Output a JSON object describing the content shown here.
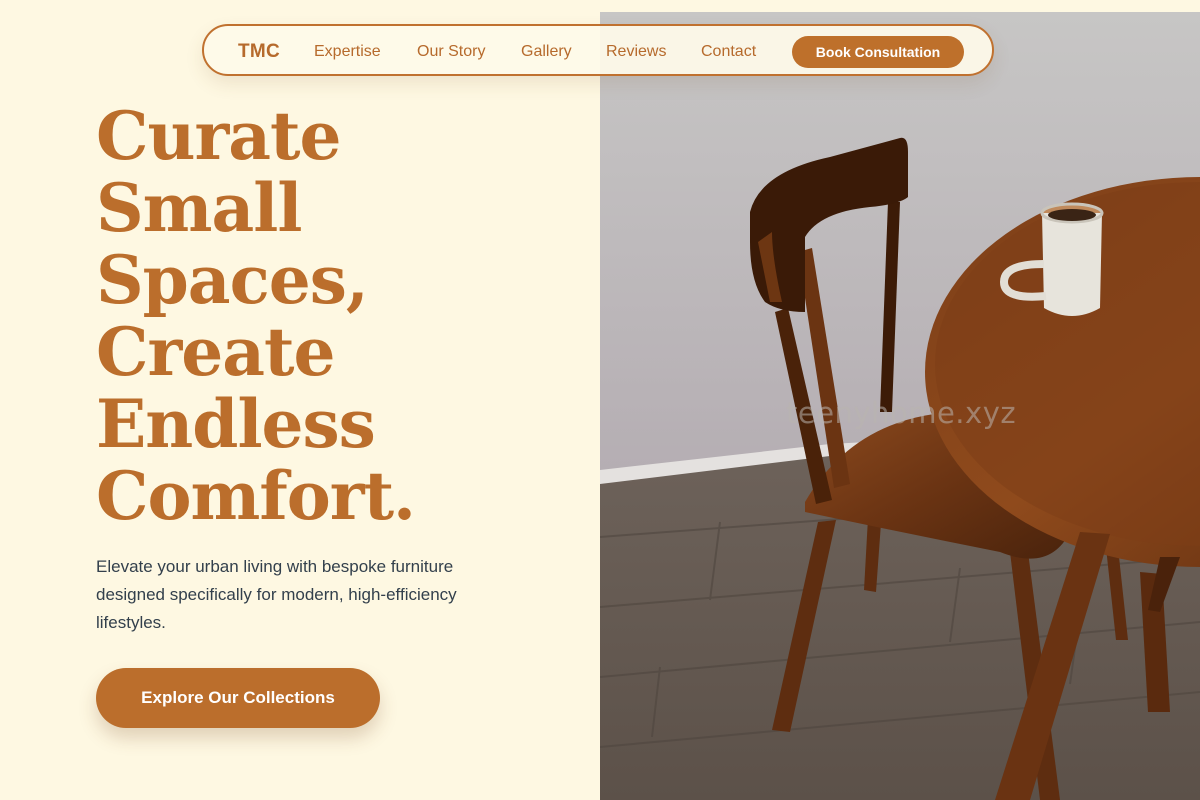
{
  "nav": {
    "brand": "TMC",
    "links": [
      "Expertise",
      "Our Story",
      "Gallery",
      "Reviews",
      "Contact"
    ],
    "cta": "Book Consultation"
  },
  "hero": {
    "headline_lines": [
      "Curate",
      "Small",
      "Spaces,",
      "Create",
      "Endless",
      "Comfort."
    ],
    "subtext": "Elevate your urban living with bespoke furniture designed specifically for modern, high-efficiency lifestyles.",
    "button": "Explore Our Collections",
    "watermark": "teenyhome.xyz"
  },
  "colors": {
    "background": "#fef8e2",
    "accent": "#bb6e2c",
    "body_text": "#33404c"
  }
}
